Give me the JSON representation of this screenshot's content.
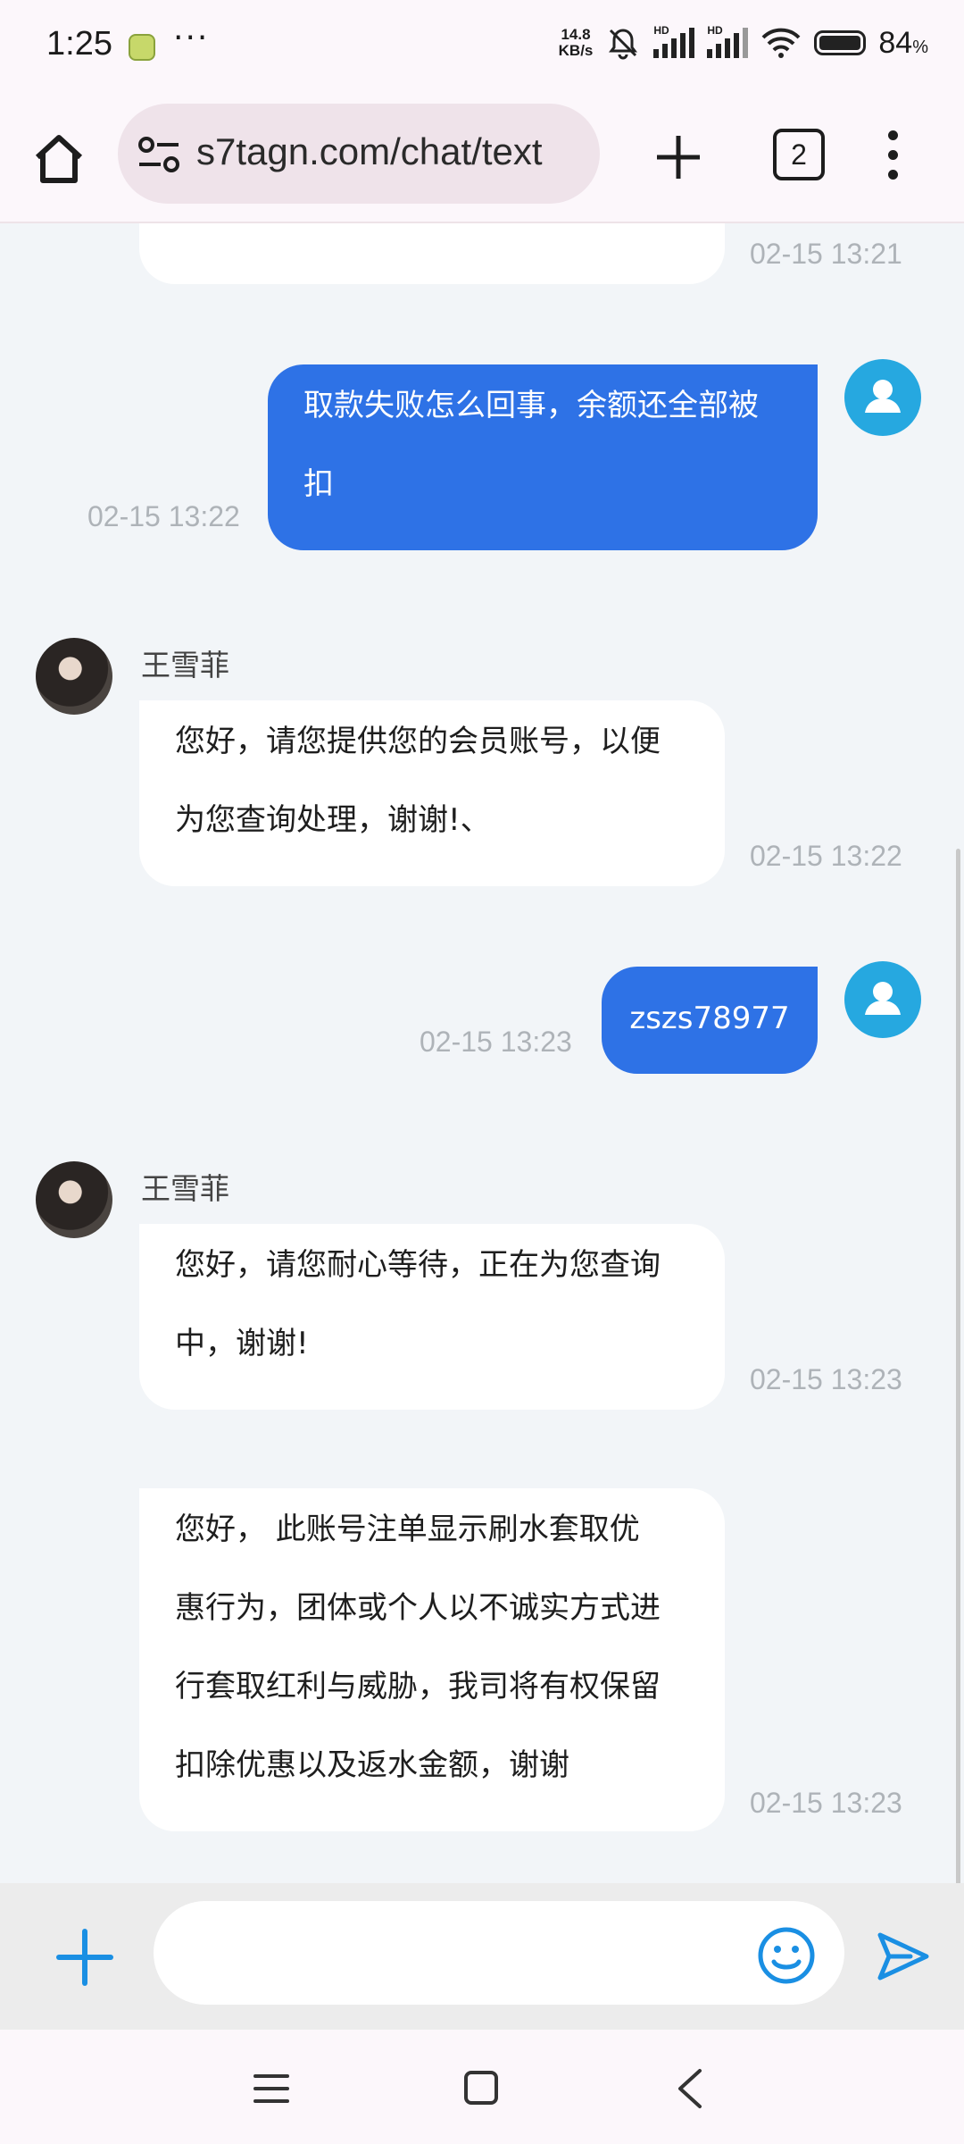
{
  "status_bar": {
    "time": "1:25",
    "more": "···",
    "net_speed_value": "14.8",
    "net_speed_unit": "KB/s",
    "signal_hd": "HD",
    "battery_percent": "84",
    "battery_unit": "%"
  },
  "browser": {
    "url": "s7tagn.com/chat/text",
    "tab_count": "2"
  },
  "chat": {
    "messages": [
      {
        "side": "in",
        "timestamp": "02-15 13:21"
      },
      {
        "side": "out",
        "lines": [
          "取款失败怎么回事，余额还全部被",
          "扣"
        ],
        "timestamp": "02-15 13:22"
      },
      {
        "side": "in",
        "sender": "王雪菲",
        "lines": [
          "您好，请您提供您的会员账号，以便",
          "为您查询处理，谢谢!、"
        ],
        "timestamp": "02-15 13:22"
      },
      {
        "side": "out",
        "lines": [
          "zszs78977"
        ],
        "timestamp": "02-15 13:23"
      },
      {
        "side": "in",
        "sender": "王雪菲",
        "lines": [
          "您好，请您耐心等待，正在为您查询",
          "中，谢谢!"
        ],
        "timestamp": "02-15 13:23"
      },
      {
        "side": "in",
        "lines": [
          "您好， 此账号注单显示刷水套取优",
          "惠行为，团体或个人以不诚实方式进",
          "行套取红利与威胁，我司将有权保留",
          "扣除优惠以及返水金额，谢谢"
        ],
        "timestamp": "02-15 13:23"
      }
    ]
  },
  "input_bar": {
    "placeholder": "",
    "accent_color": "#1a8fe3"
  },
  "colors": {
    "outgoing_bubble": "#2e72e6",
    "incoming_bubble": "#ffffff",
    "chat_background": "#f2f5f8",
    "timestamp": "#aeb3b8"
  }
}
